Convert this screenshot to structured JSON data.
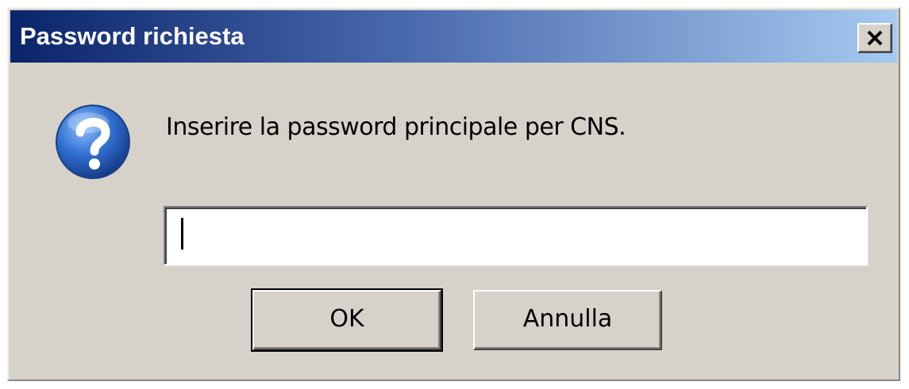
{
  "dialog": {
    "title": "Password richiesta",
    "close_label": "X",
    "prompt": "Inserire la password principale per CNS.",
    "password_value": "",
    "icon": "question-icon"
  },
  "buttons": {
    "ok_label": "OK",
    "cancel_label": "Annulla"
  },
  "colors": {
    "titlebar_start": "#0a246a",
    "titlebar_end": "#a6caf0",
    "dialog_background": "#d6d2ca",
    "icon_blue": "#2f6fd0"
  }
}
